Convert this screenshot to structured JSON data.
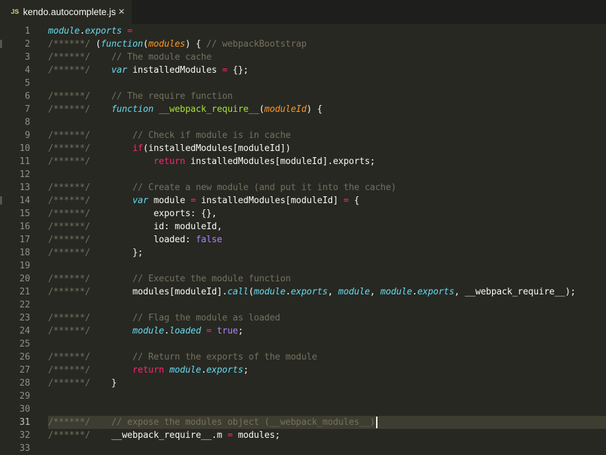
{
  "tab": {
    "icon_label": "JS",
    "file_name": "kendo.autocomplete.js",
    "close_glyph": "✕"
  },
  "theme": {
    "background": "#272822",
    "comment": "#75715e",
    "keyword": "#f92672",
    "storage": "#66d9ef",
    "function_name": "#a6e22e",
    "parameter": "#fd971f",
    "constant": "#ae81ff",
    "text": "#f8f8f2"
  },
  "editor": {
    "current_line": 31,
    "lines": [
      {
        "n": "1",
        "tokens": [
          [
            "i",
            "module"
          ],
          [
            "t",
            "."
          ],
          [
            "i",
            "exports"
          ],
          [
            "t",
            " "
          ],
          [
            "op",
            "="
          ]
        ]
      },
      {
        "n": "2",
        "tokens": [
          [
            "c",
            "/******/ "
          ],
          [
            "t",
            "("
          ],
          [
            "k",
            "function"
          ],
          [
            "t",
            "("
          ],
          [
            "p",
            "modules"
          ],
          [
            "t",
            ") { "
          ],
          [
            "c",
            "// webpackBootstrap"
          ]
        ]
      },
      {
        "n": "3",
        "tokens": [
          [
            "c",
            "/******/ "
          ],
          [
            "t",
            "   "
          ],
          [
            "c",
            "// The module cache"
          ]
        ]
      },
      {
        "n": "4",
        "tokens": [
          [
            "c",
            "/******/ "
          ],
          [
            "t",
            "   "
          ],
          [
            "k",
            "var"
          ],
          [
            "t",
            " installedModules "
          ],
          [
            "op",
            "="
          ],
          [
            "t",
            " {};"
          ]
        ]
      },
      {
        "n": "5",
        "tokens": []
      },
      {
        "n": "6",
        "tokens": [
          [
            "c",
            "/******/ "
          ],
          [
            "t",
            "   "
          ],
          [
            "c",
            "// The require function"
          ]
        ]
      },
      {
        "n": "7",
        "tokens": [
          [
            "c",
            "/******/ "
          ],
          [
            "t",
            "   "
          ],
          [
            "k",
            "function"
          ],
          [
            "t",
            " "
          ],
          [
            "g",
            "__webpack_require__"
          ],
          [
            "t",
            "("
          ],
          [
            "p",
            "moduleId"
          ],
          [
            "t",
            ") {"
          ]
        ]
      },
      {
        "n": "8",
        "tokens": []
      },
      {
        "n": "9",
        "tokens": [
          [
            "c",
            "/******/ "
          ],
          [
            "t",
            "       "
          ],
          [
            "c",
            "// Check if module is in cache"
          ]
        ]
      },
      {
        "n": "10",
        "tokens": [
          [
            "c",
            "/******/ "
          ],
          [
            "t",
            "       "
          ],
          [
            "kw",
            "if"
          ],
          [
            "t",
            "(installedModules[moduleId])"
          ]
        ]
      },
      {
        "n": "11",
        "tokens": [
          [
            "c",
            "/******/ "
          ],
          [
            "t",
            "           "
          ],
          [
            "kw",
            "return"
          ],
          [
            "t",
            " installedModules[moduleId].exports;"
          ]
        ]
      },
      {
        "n": "12",
        "tokens": []
      },
      {
        "n": "13",
        "tokens": [
          [
            "c",
            "/******/ "
          ],
          [
            "t",
            "       "
          ],
          [
            "c",
            "// Create a new module (and put it into the cache)"
          ]
        ]
      },
      {
        "n": "14",
        "tokens": [
          [
            "c",
            "/******/ "
          ],
          [
            "t",
            "       "
          ],
          [
            "k",
            "var"
          ],
          [
            "t",
            " module "
          ],
          [
            "op",
            "="
          ],
          [
            "t",
            " installedModules[moduleId] "
          ],
          [
            "op",
            "="
          ],
          [
            "t",
            " {"
          ]
        ]
      },
      {
        "n": "15",
        "tokens": [
          [
            "c",
            "/******/ "
          ],
          [
            "t",
            "           exports: {},"
          ]
        ]
      },
      {
        "n": "16",
        "tokens": [
          [
            "c",
            "/******/ "
          ],
          [
            "t",
            "           id: moduleId,"
          ]
        ]
      },
      {
        "n": "17",
        "tokens": [
          [
            "c",
            "/******/ "
          ],
          [
            "t",
            "           loaded: "
          ],
          [
            "n",
            "false"
          ]
        ]
      },
      {
        "n": "18",
        "tokens": [
          [
            "c",
            "/******/ "
          ],
          [
            "t",
            "       };"
          ]
        ]
      },
      {
        "n": "19",
        "tokens": []
      },
      {
        "n": "20",
        "tokens": [
          [
            "c",
            "/******/ "
          ],
          [
            "t",
            "       "
          ],
          [
            "c",
            "// Execute the module function"
          ]
        ]
      },
      {
        "n": "21",
        "tokens": [
          [
            "c",
            "/******/ "
          ],
          [
            "t",
            "       modules[moduleId]."
          ],
          [
            "i",
            "call"
          ],
          [
            "t",
            "("
          ],
          [
            "i",
            "module"
          ],
          [
            "t",
            "."
          ],
          [
            "i",
            "exports"
          ],
          [
            "t",
            ", "
          ],
          [
            "i",
            "module"
          ],
          [
            "t",
            ", "
          ],
          [
            "i",
            "module"
          ],
          [
            "t",
            "."
          ],
          [
            "i",
            "exports"
          ],
          [
            "t",
            ", __webpack_require__);"
          ]
        ]
      },
      {
        "n": "22",
        "tokens": []
      },
      {
        "n": "23",
        "tokens": [
          [
            "c",
            "/******/ "
          ],
          [
            "t",
            "       "
          ],
          [
            "c",
            "// Flag the module as loaded"
          ]
        ]
      },
      {
        "n": "24",
        "tokens": [
          [
            "c",
            "/******/ "
          ],
          [
            "t",
            "       "
          ],
          [
            "i",
            "module"
          ],
          [
            "t",
            "."
          ],
          [
            "i",
            "loaded"
          ],
          [
            "t",
            " "
          ],
          [
            "op",
            "="
          ],
          [
            "t",
            " "
          ],
          [
            "n",
            "true"
          ],
          [
            "t",
            ";"
          ]
        ]
      },
      {
        "n": "25",
        "tokens": []
      },
      {
        "n": "26",
        "tokens": [
          [
            "c",
            "/******/ "
          ],
          [
            "t",
            "       "
          ],
          [
            "c",
            "// Return the exports of the module"
          ]
        ]
      },
      {
        "n": "27",
        "tokens": [
          [
            "c",
            "/******/ "
          ],
          [
            "t",
            "       "
          ],
          [
            "kw",
            "return"
          ],
          [
            "t",
            " "
          ],
          [
            "i",
            "module"
          ],
          [
            "t",
            "."
          ],
          [
            "i",
            "exports"
          ],
          [
            "t",
            ";"
          ]
        ]
      },
      {
        "n": "28",
        "tokens": [
          [
            "c",
            "/******/ "
          ],
          [
            "t",
            "   }"
          ]
        ]
      },
      {
        "n": "29",
        "tokens": []
      },
      {
        "n": "30",
        "tokens": []
      },
      {
        "n": "31",
        "tokens": [
          [
            "c",
            "/******/ "
          ],
          [
            "t",
            "   "
          ],
          [
            "c",
            "// expose the modules object (__webpack_modules__)"
          ]
        ]
      },
      {
        "n": "32",
        "tokens": [
          [
            "c",
            "/******/ "
          ],
          [
            "t",
            "   __webpack_require__.m "
          ],
          [
            "op",
            "="
          ],
          [
            "t",
            " modules;"
          ]
        ]
      },
      {
        "n": "33",
        "tokens": []
      }
    ]
  }
}
